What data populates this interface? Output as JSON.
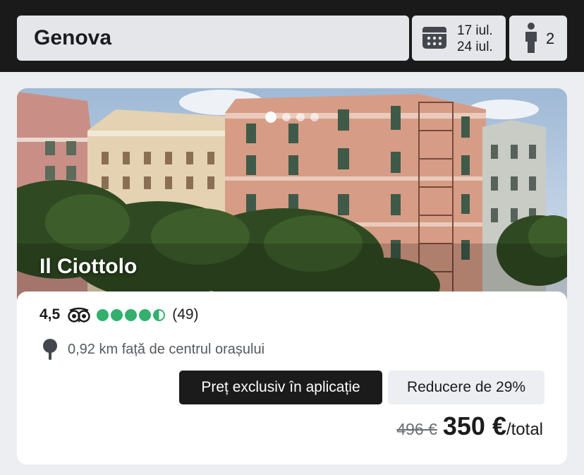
{
  "search": {
    "destination": "Genova"
  },
  "dates": {
    "checkin": "17 iul.",
    "checkout": "24 iul."
  },
  "guests": {
    "count": "2"
  },
  "hotel": {
    "name": "Il Ciottolo",
    "rating": "4,5",
    "bubbles_rating": 4.5,
    "review_count": "(49)",
    "distance": "0,92 km față de centrul orașului",
    "exclusive_label": "Preț exclusiv în aplicație",
    "discount_label": "Reducere de 29%",
    "old_price": "496 €",
    "price": "350 €",
    "price_unit": "/total",
    "gallery_total": 4,
    "gallery_active": 1
  },
  "colors": {
    "topbar": "#1a1a1a",
    "rating_green": "#34b06e",
    "badge_dark": "#1b1b1b"
  },
  "icons": [
    "calendar-icon",
    "person-icon",
    "tripadvisor-owl-icon",
    "location-pin-icon"
  ]
}
